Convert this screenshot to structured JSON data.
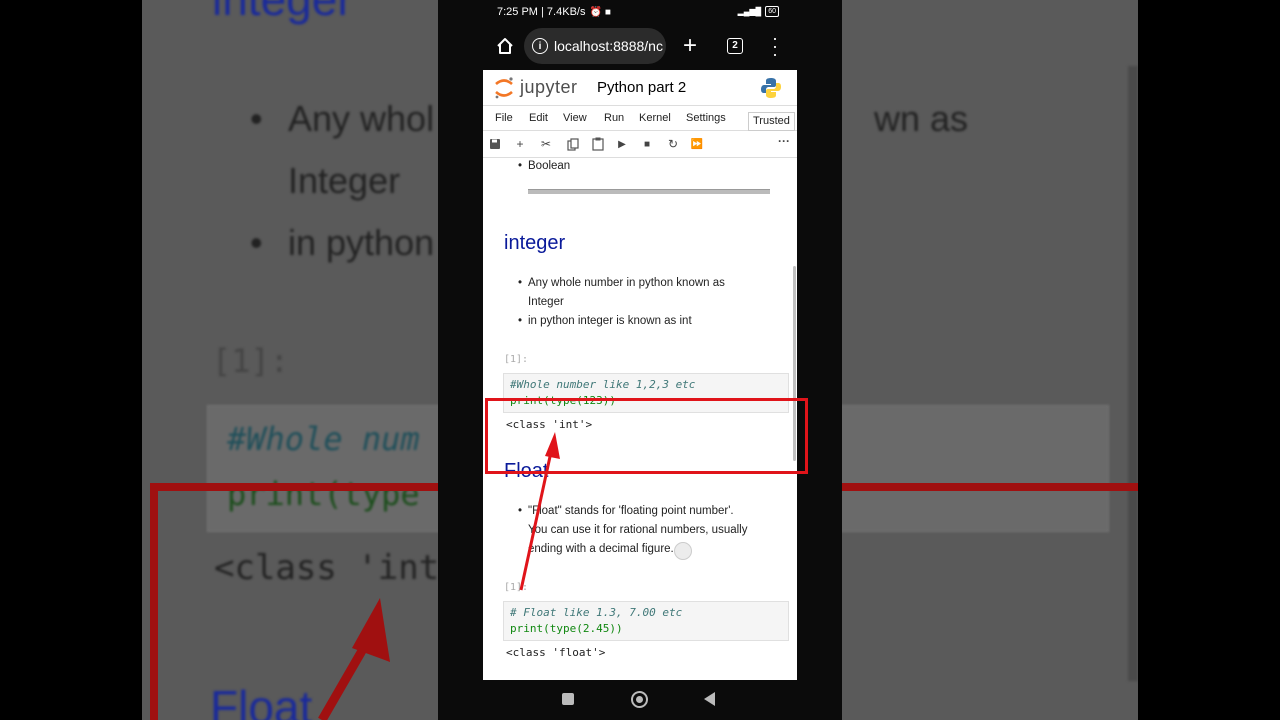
{
  "background_zoom": {
    "heading": "integer",
    "bullet1_line1": "Any whol",
    "bullet1_line1_end": "wn as",
    "bullet1_line2": "Integer",
    "bullet2": "in python",
    "prompt": "[1]:",
    "code1": "#Whole num",
    "code2": "print(type",
    "output": "<class 'int",
    "float_heading": "Float"
  },
  "status_bar": {
    "time_speed": "7:25 PM | 7.4KB/s",
    "battery": "60"
  },
  "browser": {
    "url": "localhost:8888/nc",
    "tab_count": "2"
  },
  "jupyter": {
    "wordmark": "jupyter",
    "notebook_title": "Python part 2",
    "menu": [
      "File",
      "Edit",
      "View",
      "Run",
      "Kernel",
      "Settings"
    ],
    "trusted": "Trusted"
  },
  "notebook": {
    "top_bullet": "Boolean",
    "integer_heading": "integer",
    "integer_bullets": [
      "Any whole number in python known as",
      "Integer",
      "in python integer is known as int"
    ],
    "cell1": {
      "prompt": "[1]:",
      "line1": "#Whole number like 1,2,3 etc",
      "line2": "print(type(123))",
      "output": "<class 'int'>"
    },
    "float_heading": "Float",
    "float_bullets": [
      "\"Float\" stands for 'floating point number'.",
      "You can use it for rational numbers, usually",
      "ending with a decimal figure."
    ],
    "cell2": {
      "prompt": "[1]:",
      "line1": "# Float like 1.3, 7.00 etc",
      "line2": "print(type(2.45))",
      "output": "<class 'float'>"
    }
  },
  "colors": {
    "annotation_red": "#e0141a",
    "heading_blue": "#0a1a9a"
  }
}
